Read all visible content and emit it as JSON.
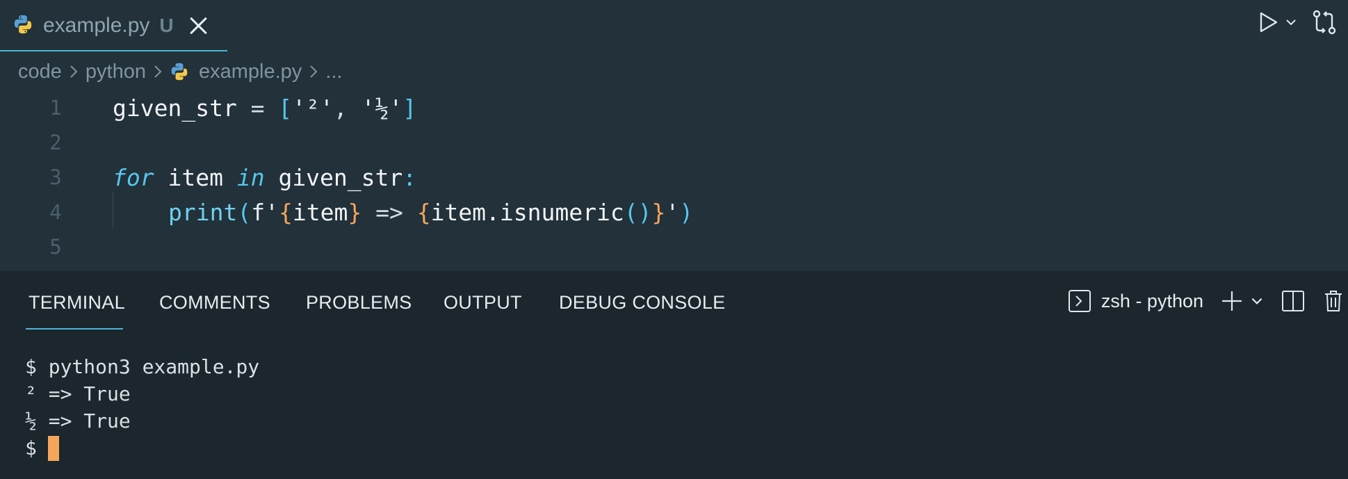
{
  "tab": {
    "filename": "example.py",
    "badge": "U"
  },
  "breadcrumb": {
    "items": [
      "code",
      "python",
      "example.py",
      "..."
    ]
  },
  "editor": {
    "line_numbers": [
      "1",
      "2",
      "3",
      "4",
      "5"
    ],
    "lines": {
      "l1": {
        "var": "given_str",
        "eq": " = ",
        "open": "[",
        "s1": "'²'",
        "comma": ", ",
        "s2": "'½'",
        "close": "]"
      },
      "l3": {
        "kw_for": "for",
        "item": " item ",
        "kw_in": "in",
        "iter": " given_str",
        "colon": ":"
      },
      "l4": {
        "fn": "print",
        "lp": "(",
        "fpre": "f'",
        "cb1o": "{",
        "v1": "item",
        "cb1c": "}",
        "arrow": " => ",
        "cb2o": "{",
        "v2": "item.isnumeric",
        "parens": "()",
        "cb2c": "}",
        "fend": "'",
        "rp": ")"
      }
    }
  },
  "panel": {
    "tabs": [
      "TERMINAL",
      "COMMENTS",
      "PROBLEMS",
      "OUTPUT",
      "DEBUG CONSOLE"
    ],
    "active_tab": "TERMINAL",
    "shell_label": "zsh - python"
  },
  "terminal": {
    "lines": [
      "$ python3 example.py",
      "² => True",
      "½ => True"
    ],
    "prompt": "$"
  },
  "colors": {
    "accent": "#4fb5d6",
    "cursor": "#f5a65b",
    "editor_bg": "#22313a",
    "panel_bg": "#1b262d"
  }
}
